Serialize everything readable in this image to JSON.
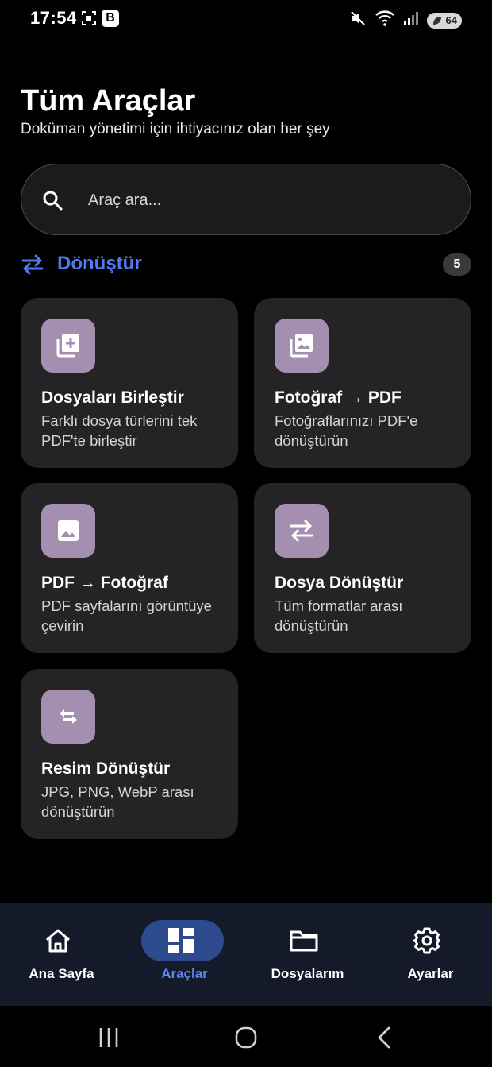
{
  "status_bar": {
    "time": "17:54",
    "badge": "B",
    "battery": "64",
    "icons": [
      "screenshot-icon",
      "b-badge",
      "mute-icon",
      "wifi-icon",
      "signal-icon",
      "battery-icon"
    ]
  },
  "header": {
    "title": "Tüm Araçlar",
    "subtitle": "Doküman yönetimi için ihtiyacınız olan her şey"
  },
  "search": {
    "placeholder": "Araç ara...",
    "value": ""
  },
  "section": {
    "title": "Dönüştür",
    "count": "5",
    "icon": "swap-icon",
    "accent": "#4f79f0"
  },
  "tools": [
    {
      "title": "Dosyaları Birleştir",
      "description": "Farklı dosya türlerini tek PDF'te birleştir",
      "icon": "add-to-stack-icon"
    },
    {
      "title": "Fotoğraf → PDF",
      "description": "Fotoğraflarınızı PDF'e dönüştürün",
      "icon": "photo-library-icon"
    },
    {
      "title": "PDF → Fotoğraf",
      "description": "PDF sayfalarını görüntüye çevirin",
      "icon": "image-icon"
    },
    {
      "title": "Dosya Dönüştür",
      "description": "Tüm formatlar arası dönüştürün",
      "icon": "swap-horizontal-icon"
    },
    {
      "title": "Resim Dönüştür",
      "description": "JPG, PNG, WebP arası dönüştürün",
      "icon": "swap-arrows-icon"
    }
  ],
  "colors": {
    "background": "#000000",
    "card": "#242426",
    "icon_tile": "#a58fb1",
    "nav_background": "#141a2a",
    "nav_active_pill": "#2d4a8f",
    "nav_active_label": "#5b86f5"
  },
  "bottom_nav": {
    "items": [
      {
        "label": "Ana Sayfa",
        "icon": "home-icon",
        "active": false
      },
      {
        "label": "Araçlar",
        "icon": "dashboard-icon",
        "active": true
      },
      {
        "label": "Dosyalarım",
        "icon": "folder-icon",
        "active": false
      },
      {
        "label": "Ayarlar",
        "icon": "gear-icon",
        "active": false
      }
    ]
  },
  "system_nav": {
    "buttons": [
      "recents-icon",
      "home-circle-icon",
      "back-icon"
    ]
  }
}
